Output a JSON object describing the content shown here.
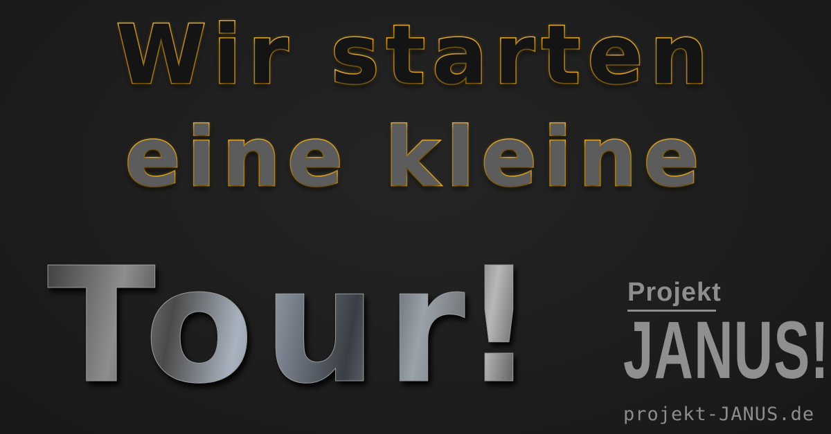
{
  "headline": {
    "line1": "Wir starten",
    "line2": "eine kleine"
  },
  "tour": {
    "word": "Tour",
    "exclamation": "!"
  },
  "logo": {
    "small": "Projekt",
    "big": "JANUS!",
    "url": "projekt-JANUS.de"
  },
  "colors": {
    "background": "#1f1f1f",
    "outline_gold": "#f0b22a",
    "logo_gray": "#8f8f8f"
  }
}
